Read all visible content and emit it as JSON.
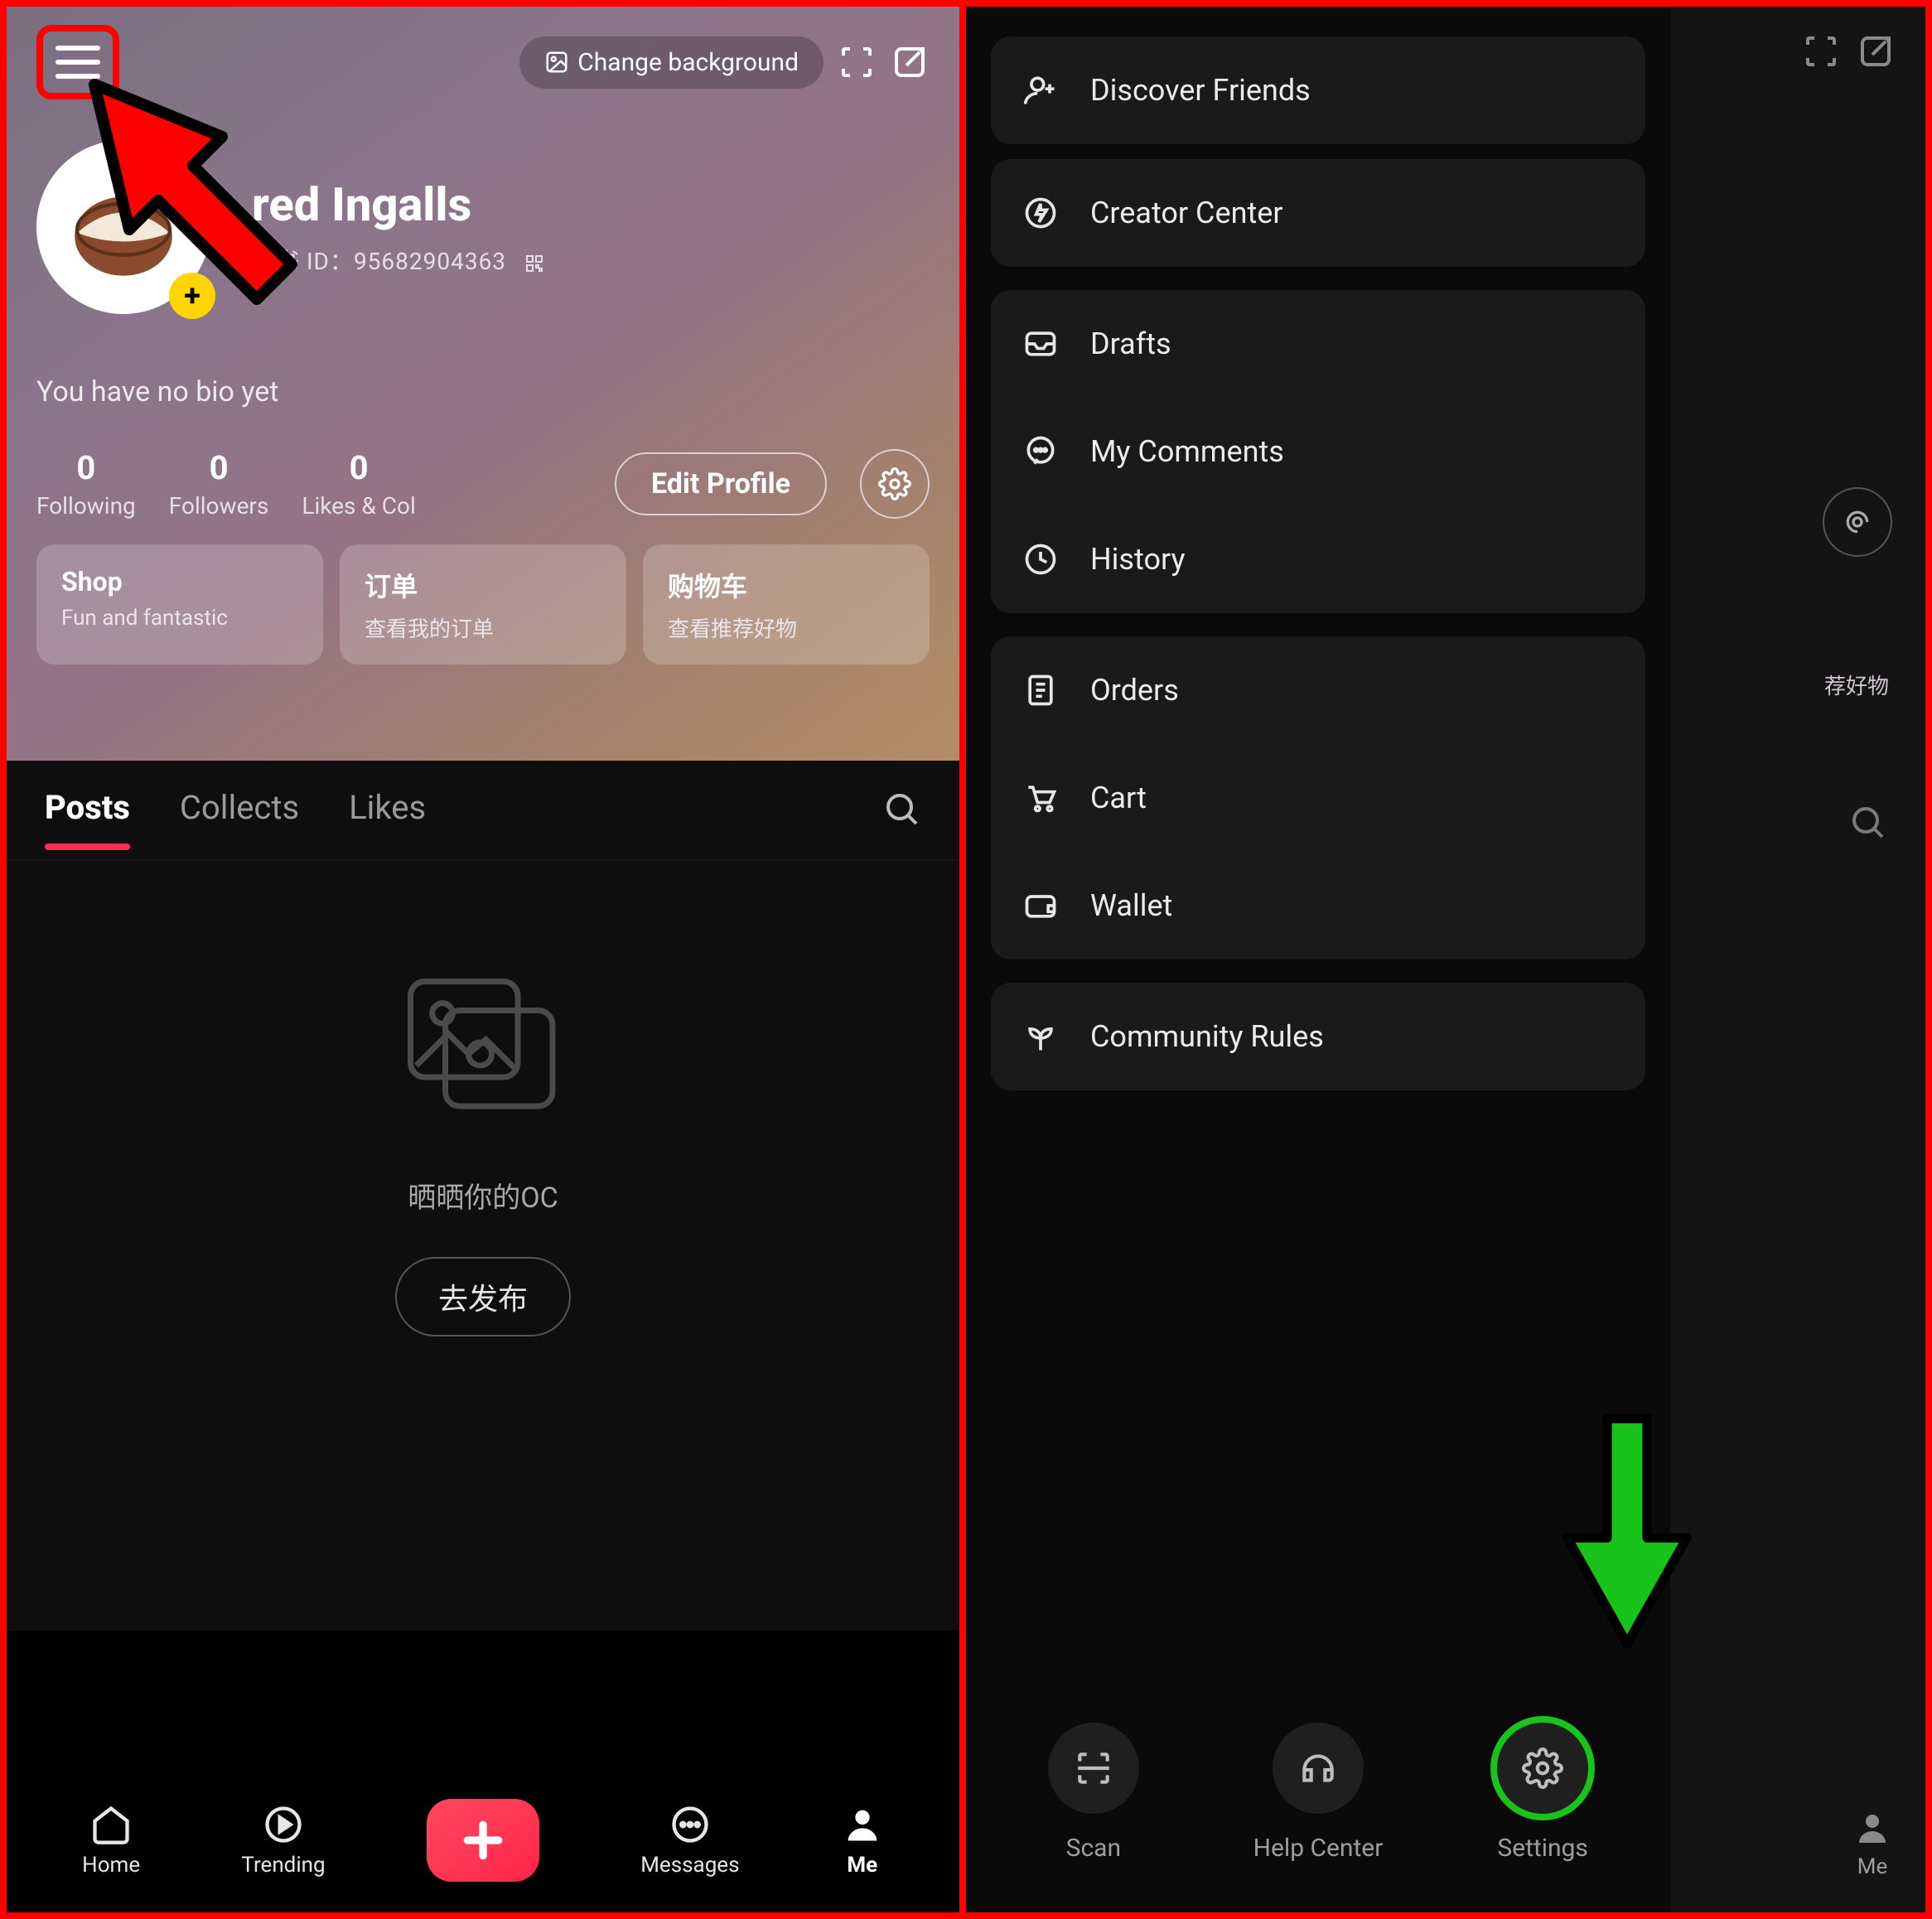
{
  "left": {
    "topbar": {
      "change_background": "Change background"
    },
    "profile": {
      "display_name": "red Ingalls",
      "id_label_prefix": "红书 ID：",
      "id_value": "95682904363",
      "bio_empty": "You have no bio yet"
    },
    "stats": {
      "following_count": "0",
      "following_label": "Following",
      "followers_count": "0",
      "followers_label": "Followers",
      "likescol_count": "0",
      "likescol_label": "Likes & Col"
    },
    "actions": {
      "edit_profile": "Edit Profile"
    },
    "cards": {
      "shop_title": "Shop",
      "shop_sub": "Fun and fantastic",
      "orders_title": "订单",
      "orders_sub": "查看我的订单",
      "cart_title": "购物车",
      "cart_sub": "查看推荐好物"
    },
    "tabs": {
      "posts": "Posts",
      "collects": "Collects",
      "likes": "Likes"
    },
    "empty": {
      "prompt": "晒晒你的OC",
      "publish": "去发布"
    },
    "nav": {
      "home": "Home",
      "trending": "Trending",
      "messages": "Messages",
      "me": "Me"
    }
  },
  "right": {
    "menu": {
      "discover_friends": "Discover Friends",
      "creator_center": "Creator Center",
      "drafts": "Drafts",
      "my_comments": "My Comments",
      "history": "History",
      "orders": "Orders",
      "cart": "Cart",
      "wallet": "Wallet",
      "community_rules": "Community Rules"
    },
    "tools": {
      "scan": "Scan",
      "help_center": "Help Center",
      "settings": "Settings"
    },
    "slice": {
      "card_sub": "荐好物",
      "nav_me": "Me"
    }
  }
}
